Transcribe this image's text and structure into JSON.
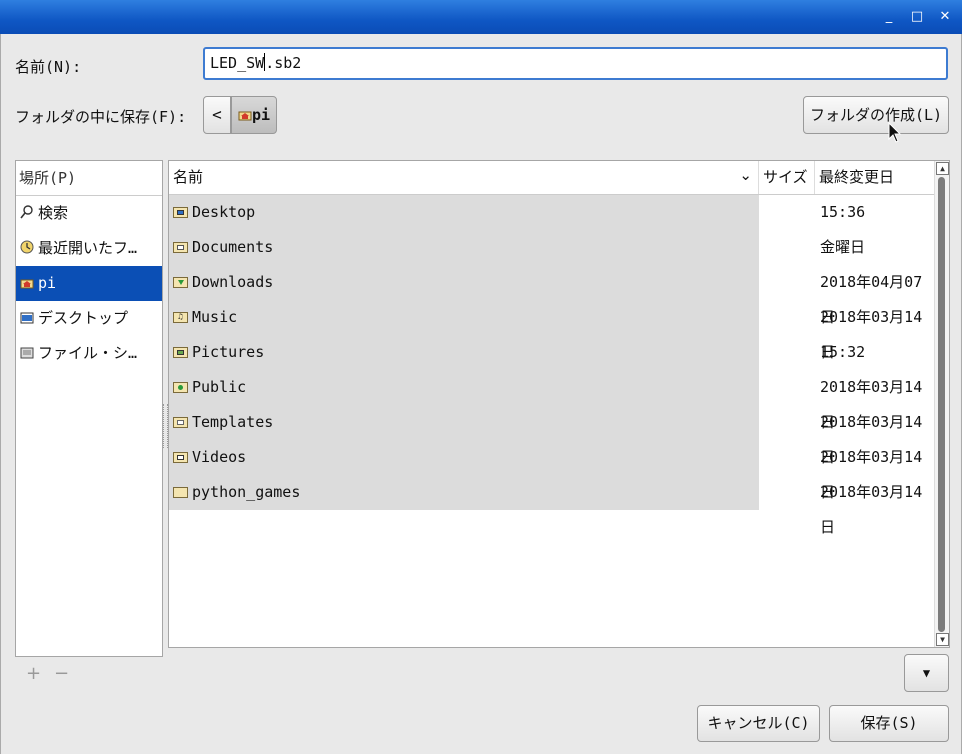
{
  "window": {
    "minimize_label": "_",
    "maximize_label": "□",
    "close_label": "✕"
  },
  "form": {
    "name_label": "名前(N):",
    "name_before_caret": "LED_SW",
    "name_after_caret": ".sb2",
    "folder_label": "フォルダの中に保存(F):",
    "path_back_label": "<",
    "path_current": "pi",
    "create_folder_label": "フォルダの作成(L)"
  },
  "places": {
    "header": "場所(P)",
    "items": [
      {
        "label": "検索",
        "icon": "search-icon",
        "selected": false
      },
      {
        "label": "最近開いたフ…",
        "icon": "recent-icon",
        "selected": false
      },
      {
        "label": "pi",
        "icon": "home-icon",
        "selected": true
      },
      {
        "label": "デスクトップ",
        "icon": "desktop-icon",
        "selected": false
      },
      {
        "label": "ファイル・シ…",
        "icon": "drive-icon",
        "selected": false
      }
    ],
    "add_label": "+",
    "remove_label": "−"
  },
  "files": {
    "columns": {
      "name": "名前",
      "size": "サイズ",
      "modified": "最終変更日"
    },
    "sort_indicator": "⌄",
    "rows": [
      {
        "name": "Desktop",
        "icon": "desktop-folder-icon",
        "modified": "15:36"
      },
      {
        "name": "Documents",
        "icon": "documents-folder-icon",
        "modified": "金曜日"
      },
      {
        "name": "Downloads",
        "icon": "downloads-folder-icon",
        "modified": "2018年04月07日"
      },
      {
        "name": "Music",
        "icon": "music-folder-icon",
        "modified": "2018年03月14日"
      },
      {
        "name": "Pictures",
        "icon": "pictures-folder-icon",
        "modified": "15:32"
      },
      {
        "name": "Public",
        "icon": "public-folder-icon",
        "modified": "2018年03月14日"
      },
      {
        "name": "Templates",
        "icon": "templates-folder-icon",
        "modified": "2018年03月14日"
      },
      {
        "name": "Videos",
        "icon": "videos-folder-icon",
        "modified": "2018年03月14日"
      },
      {
        "name": "python_games",
        "icon": "folder-icon",
        "modified": "2018年03月14日"
      }
    ]
  },
  "actions": {
    "cancel_label": "キャンセル(C)",
    "save_label": "保存(S)",
    "filter_dropdown_glyph": "▼"
  },
  "colors": {
    "titlebar": "#0f57c4",
    "selection": "#0b4fb5",
    "focus_border": "#3d7bd1"
  }
}
